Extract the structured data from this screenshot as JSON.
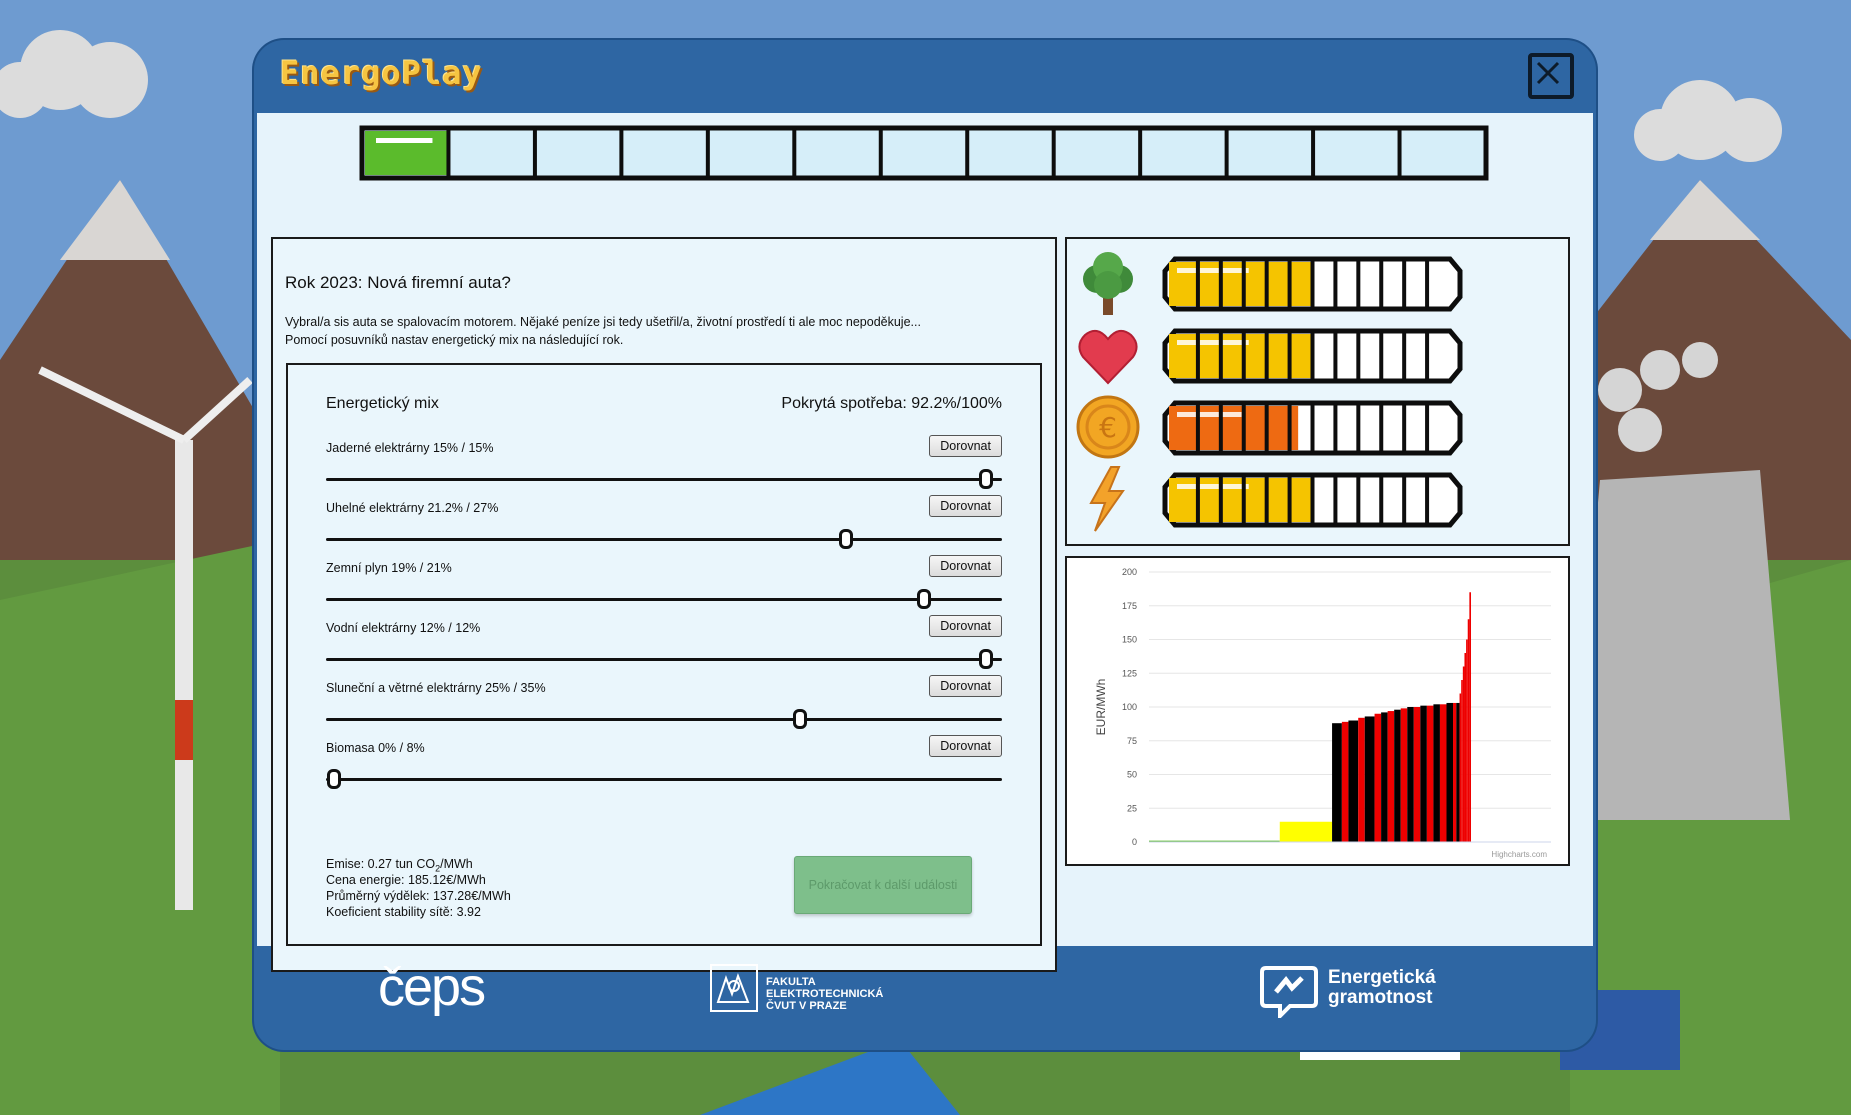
{
  "app": {
    "logo_text": "EnergoPlay",
    "close_icon": "close-icon",
    "accent": "#2e66a3"
  },
  "progress": {
    "segments_total": 13,
    "segments_filled": 1,
    "fill_color": "#5bbb2c"
  },
  "event": {
    "title": "Rok 2023: Nová firemní auta?",
    "text_line1": "Vybral/a sis auta se spalovacím motorem. Nějaké peníze jsi tedy ušetřil/a, životní prostředí ti ale moc nepoděkuje...",
    "text_line2": "Pomocí posuvníků nastav energetický mix na následující rok."
  },
  "mix": {
    "heading": "Energetický mix",
    "coverage": "Pokrytá spotřeba: 92.2%/100%",
    "sources": [
      {
        "label": "Jaderné elektrárny 15% / 15%",
        "button": "Dorovnat",
        "value": 15,
        "max": 15
      },
      {
        "label": "Uhelné elektrárny 21.2% / 27%",
        "button": "Dorovnat",
        "value": 21.2,
        "max": 27
      },
      {
        "label": "Zemní plyn 19% / 21%",
        "button": "Dorovnat",
        "value": 19,
        "max": 21
      },
      {
        "label": "Vodní elektrárny 12% / 12%",
        "button": "Dorovnat",
        "value": 12,
        "max": 12
      },
      {
        "label": "Sluneční a větrné elektrárny 25% / 35%",
        "button": "Dorovnat",
        "value": 25,
        "max": 35
      },
      {
        "label": "Biomasa 0% / 8%",
        "button": "Dorovnat",
        "value": 0,
        "max": 8
      }
    ],
    "stats": {
      "emissions_prefix": "Emise: 0.27 tun CO",
      "emissions_sub": "2",
      "emissions_suffix": "/MWh",
      "energy_price": "Cena energie: 185.12€/MWh",
      "avg_income": "Průměrný výdělek: 137.28€/MWh",
      "grid_stability": "Koeficient stability sítě: 3.92"
    },
    "continue_button": "Pokračovat k další události"
  },
  "status": [
    {
      "icon": "tree-icon",
      "level": 0.5,
      "color": "#f5c400"
    },
    {
      "icon": "heart-icon",
      "level": 0.5,
      "color": "#f5c400"
    },
    {
      "icon": "euro-coin-icon",
      "level": 0.45,
      "color": "#ee6a12"
    },
    {
      "icon": "lightning-icon",
      "level": 0.5,
      "color": "#f5c400"
    }
  ],
  "chart_data": {
    "type": "bar",
    "title": "",
    "xlabel": "",
    "ylabel": "EUR/MWh",
    "ylim": [
      0,
      200
    ],
    "yticks": [
      "0",
      "25",
      "50",
      "75",
      "100",
      "125",
      "150",
      "175",
      "200"
    ],
    "grid": true,
    "credit": "Highcharts.com",
    "note": "Merit-order supply curve: each bar is one supply block, ordered by price; width = share of supply",
    "series": [
      {
        "blocks": [
          [
            0.4,
            1,
            "#5bbb2c"
          ],
          [
            0.16,
            15,
            "#ffff00"
          ],
          [
            0.03,
            88,
            "#000"
          ],
          [
            0.02,
            89,
            "#e00"
          ],
          [
            0.03,
            90,
            "#000"
          ],
          [
            0.02,
            92,
            "#e00"
          ],
          [
            0.03,
            93,
            "#000"
          ],
          [
            0.02,
            95,
            "#e00"
          ],
          [
            0.02,
            96,
            "#000"
          ],
          [
            0.02,
            97,
            "#e00"
          ],
          [
            0.02,
            98,
            "#000"
          ],
          [
            0.02,
            99,
            "#e00"
          ],
          [
            0.02,
            100,
            "#000"
          ],
          [
            0.02,
            100,
            "#e00"
          ],
          [
            0.02,
            101,
            "#000"
          ],
          [
            0.02,
            101,
            "#e00"
          ],
          [
            0.02,
            102,
            "#000"
          ],
          [
            0.02,
            102,
            "#e00"
          ],
          [
            0.02,
            103,
            "#000"
          ],
          [
            0.01,
            103,
            "#e00"
          ],
          [
            0.01,
            103,
            "#000"
          ],
          [
            0.005,
            110,
            "#e00"
          ],
          [
            0.005,
            120,
            "#e00"
          ],
          [
            0.005,
            130,
            "#e00"
          ],
          [
            0.005,
            140,
            "#e00"
          ],
          [
            0.005,
            150,
            "#e00"
          ],
          [
            0.005,
            165,
            "#e00"
          ],
          [
            0.005,
            185,
            "#e00"
          ]
        ]
      }
    ]
  },
  "footer": {
    "logo1": "čeps",
    "logo2_line1": "FAKULTA",
    "logo2_line2": "ELEKTROTECHNICKÁ",
    "logo2_line3": "ČVUT V PRAZE",
    "logo3_line1": "Energetická",
    "logo3_line2": "gramotnost"
  }
}
